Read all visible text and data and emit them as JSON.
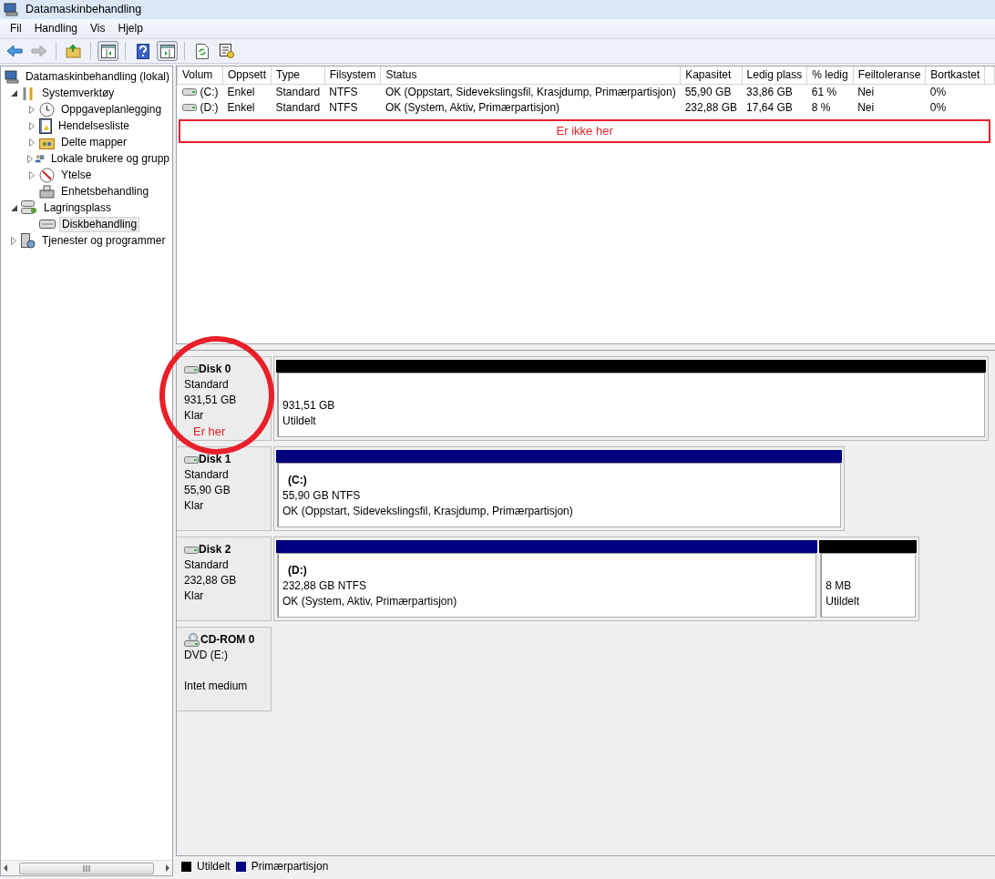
{
  "window": {
    "title": "Datamaskinbehandling"
  },
  "menu": [
    "Fil",
    "Handling",
    "Vis",
    "Hjelp"
  ],
  "toolbar": [
    {
      "kind": "back",
      "disabled": false,
      "pressed": false
    },
    {
      "kind": "forward",
      "disabled": true,
      "pressed": false
    },
    {
      "kind": "up",
      "disabled": false,
      "pressed": false
    },
    {
      "kind": "tree-pane",
      "disabled": false,
      "pressed": true
    },
    {
      "kind": "help",
      "disabled": false,
      "pressed": false
    },
    {
      "kind": "action-pane",
      "disabled": false,
      "pressed": true
    },
    {
      "kind": "refresh",
      "disabled": false,
      "pressed": false
    },
    {
      "kind": "export",
      "disabled": false,
      "pressed": false
    }
  ],
  "tree": [
    {
      "label": "Datamaskinbehandling (lokal)",
      "selected": false,
      "children": [
        {
          "label": "Systemverktøy",
          "expanded": true,
          "selected": false,
          "children": [
            {
              "label": "Oppgaveplanlegging",
              "expanded": false,
              "selected": false
            },
            {
              "label": "Hendelsesliste",
              "expanded": false,
              "selected": false
            },
            {
              "label": "Delte mapper",
              "expanded": false,
              "selected": false
            },
            {
              "label": "Lokale brukere og grupp",
              "expanded": false,
              "selected": false
            },
            {
              "label": "Ytelse",
              "expanded": false,
              "selected": false
            },
            {
              "label": "Enhetsbehandling",
              "selected": false
            }
          ]
        },
        {
          "label": "Lagringsplass",
          "expanded": true,
          "selected": false,
          "children": [
            {
              "label": "Diskbehandling",
              "selected": true
            }
          ]
        },
        {
          "label": "Tjenester og programmer",
          "expanded": false,
          "selected": false
        }
      ]
    }
  ],
  "volumes": {
    "columns": [
      "Volum",
      "Oppsett",
      "Type",
      "Filsystem",
      "Status",
      "Kapasitet",
      "Ledig plass",
      "% ledig",
      "Feiltoleranse",
      "Bortkastet"
    ],
    "rows": [
      [
        "(C:)",
        "Enkel",
        "Standard",
        "NTFS",
        "OK (Oppstart, Sidevekslingsfil, Krasjdump, Primærpartisjon)",
        "55,90 GB",
        "33,86 GB",
        "61 %",
        "Nei",
        "0%"
      ],
      [
        "(D:)",
        "Enkel",
        "Standard",
        "NTFS",
        "OK (System, Aktiv, Primærpartisjon)",
        "232,88 GB",
        "17,64 GB",
        "8 %",
        "Nei",
        "0%"
      ]
    ],
    "annotation": "Er ikke her"
  },
  "disks": [
    {
      "kind": "disk",
      "name": "Disk 0",
      "lines": [
        "Standard",
        "931,51 GB",
        "Klar"
      ],
      "note": "Er her",
      "partitions": [
        {
          "kind": "unallocated",
          "lines": [
            "931,51 GB",
            "Utildelt"
          ]
        }
      ]
    },
    {
      "kind": "disk",
      "name": "Disk 1",
      "lines": [
        "Standard",
        "55,90 GB",
        "Klar"
      ],
      "partitions": [
        {
          "kind": "primary",
          "title": "(C:)",
          "lines": [
            "55,90 GB NTFS",
            "OK (Oppstart, Sidevekslingsfil, Krasjdump, Primærpartisjon)"
          ]
        }
      ]
    },
    {
      "kind": "disk",
      "name": "Disk 2",
      "lines": [
        "Standard",
        "232,88 GB",
        "Klar"
      ],
      "partitions": [
        {
          "kind": "primary",
          "title": "(D:)",
          "lines": [
            "232,88 GB NTFS",
            "OK (System, Aktiv, Primærpartisjon)"
          ]
        },
        {
          "kind": "unallocated",
          "lines": [
            "8 MB",
            "Utildelt"
          ]
        }
      ]
    },
    {
      "kind": "cdrom",
      "name": "CD-ROM 0",
      "lines": [
        "DVD (E:)"
      ],
      "status": "Intet medium"
    }
  ],
  "legend": [
    {
      "label": "Utildelt",
      "color": "#000000"
    },
    {
      "label": "Primærpartisjon",
      "color": "#000080"
    }
  ]
}
